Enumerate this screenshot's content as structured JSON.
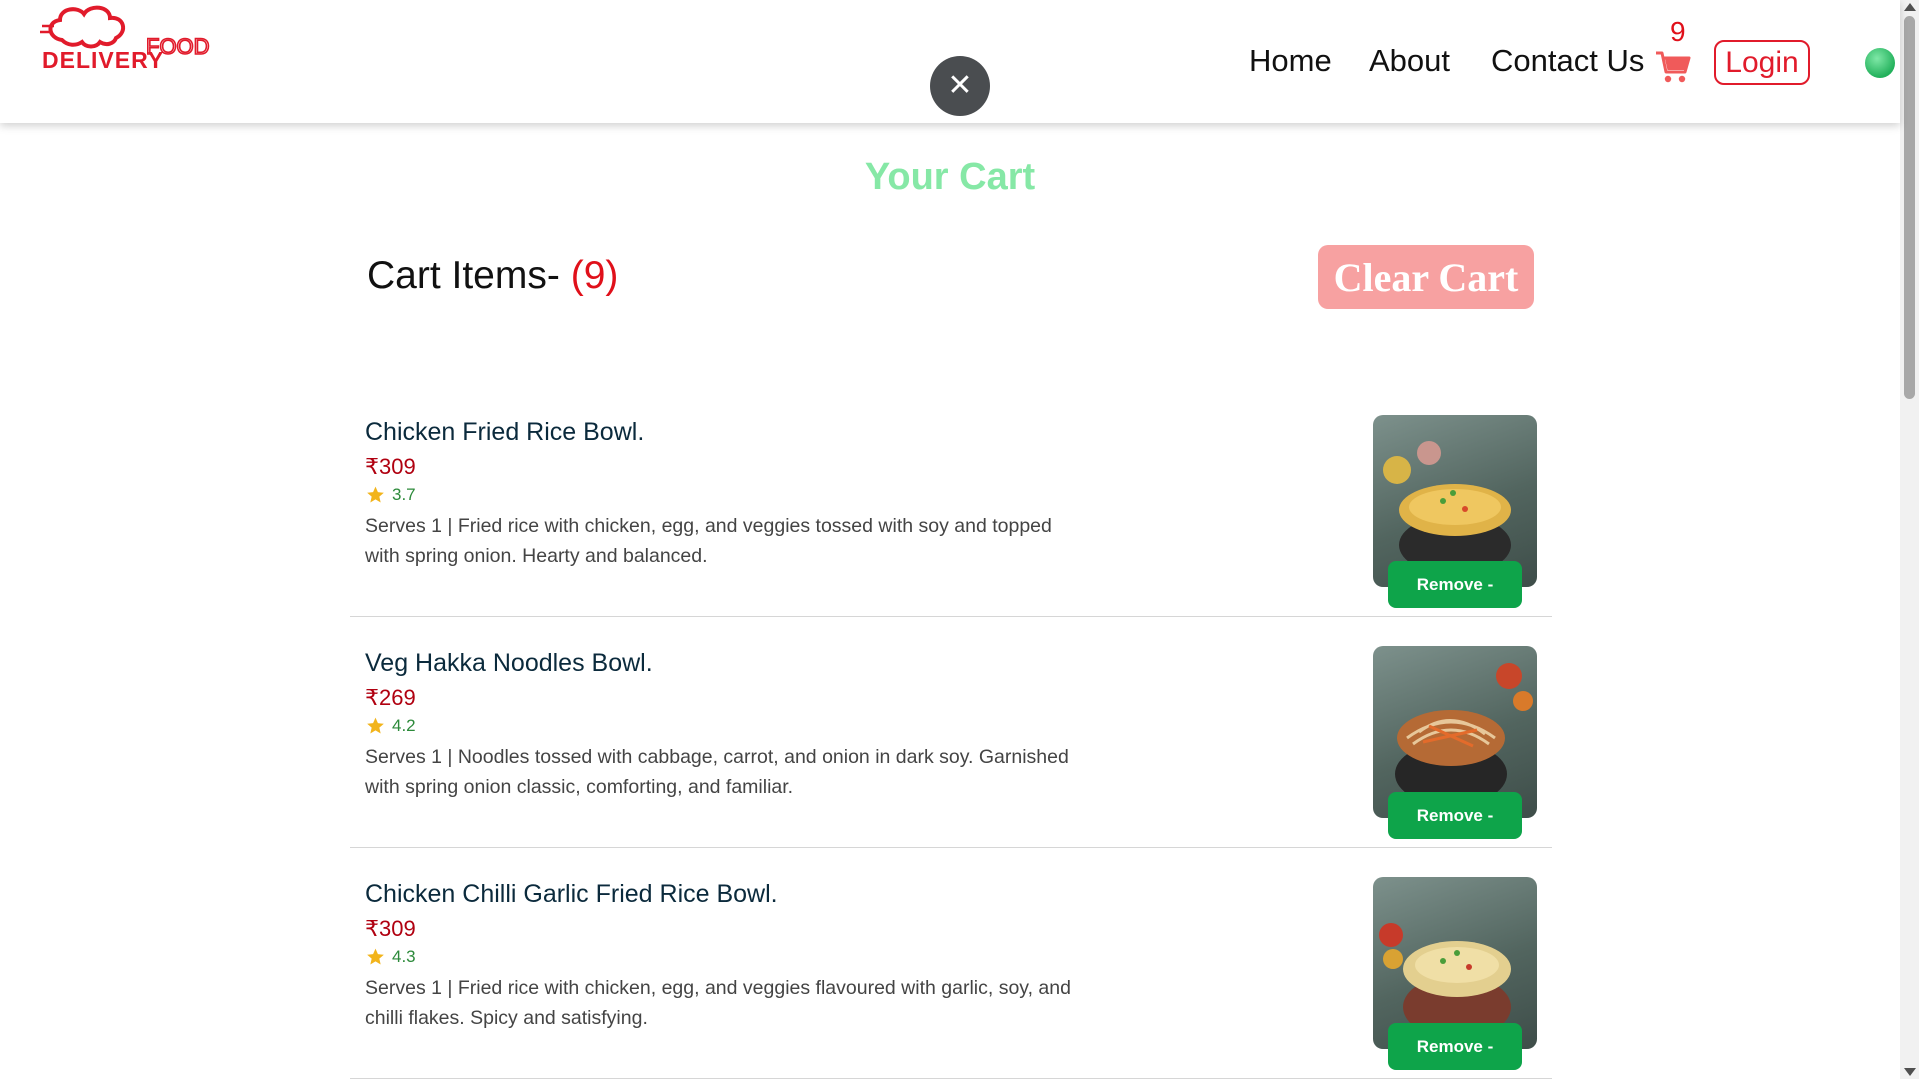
{
  "header": {
    "logo_top": "FOOD",
    "logo_bottom": "DELIVERY",
    "close_symbol": "✕",
    "nav": {
      "home": "Home",
      "about": "About",
      "contact": "Contact Us"
    },
    "cart_count": "9",
    "login": "Login"
  },
  "main": {
    "title": "Your Cart",
    "cart_items_label": "Cart Items-",
    "cart_items_count": "(9)",
    "clear_cart": "Clear Cart"
  },
  "items": [
    {
      "name": "Chicken Fried Rice Bowl.",
      "price": "₹309",
      "rating": "3.7",
      "description": "Serves 1 | Fried rice with chicken, egg, and veggies tossed with soy and topped with spring onion. Hearty and balanced.",
      "remove_label": "Remove -"
    },
    {
      "name": "Veg Hakka Noodles Bowl.",
      "price": "₹269",
      "rating": "4.2",
      "description": "Serves 1 | Noodles tossed with cabbage, carrot, and onion in dark soy. Garnished with spring onion classic, comforting, and familiar.",
      "remove_label": "Remove -"
    },
    {
      "name": "Chicken Chilli Garlic Fried Rice Bowl.",
      "price": "₹309",
      "rating": "4.3",
      "description": "Serves 1 | Fried rice with chicken, egg, and veggies flavoured with garlic, soy, and chilli flakes. Spicy and satisfying.",
      "remove_label": "Remove -"
    }
  ],
  "colors": {
    "brand_red": "#e11b2b",
    "title_green": "#86e8a6",
    "remove_green": "#0ea44a",
    "clear_pink": "#f7a1a1",
    "price_red": "#b00010"
  },
  "icons": [
    "chef-hat-logo",
    "close-icon",
    "cart-icon",
    "star-icon",
    "status-dot"
  ]
}
